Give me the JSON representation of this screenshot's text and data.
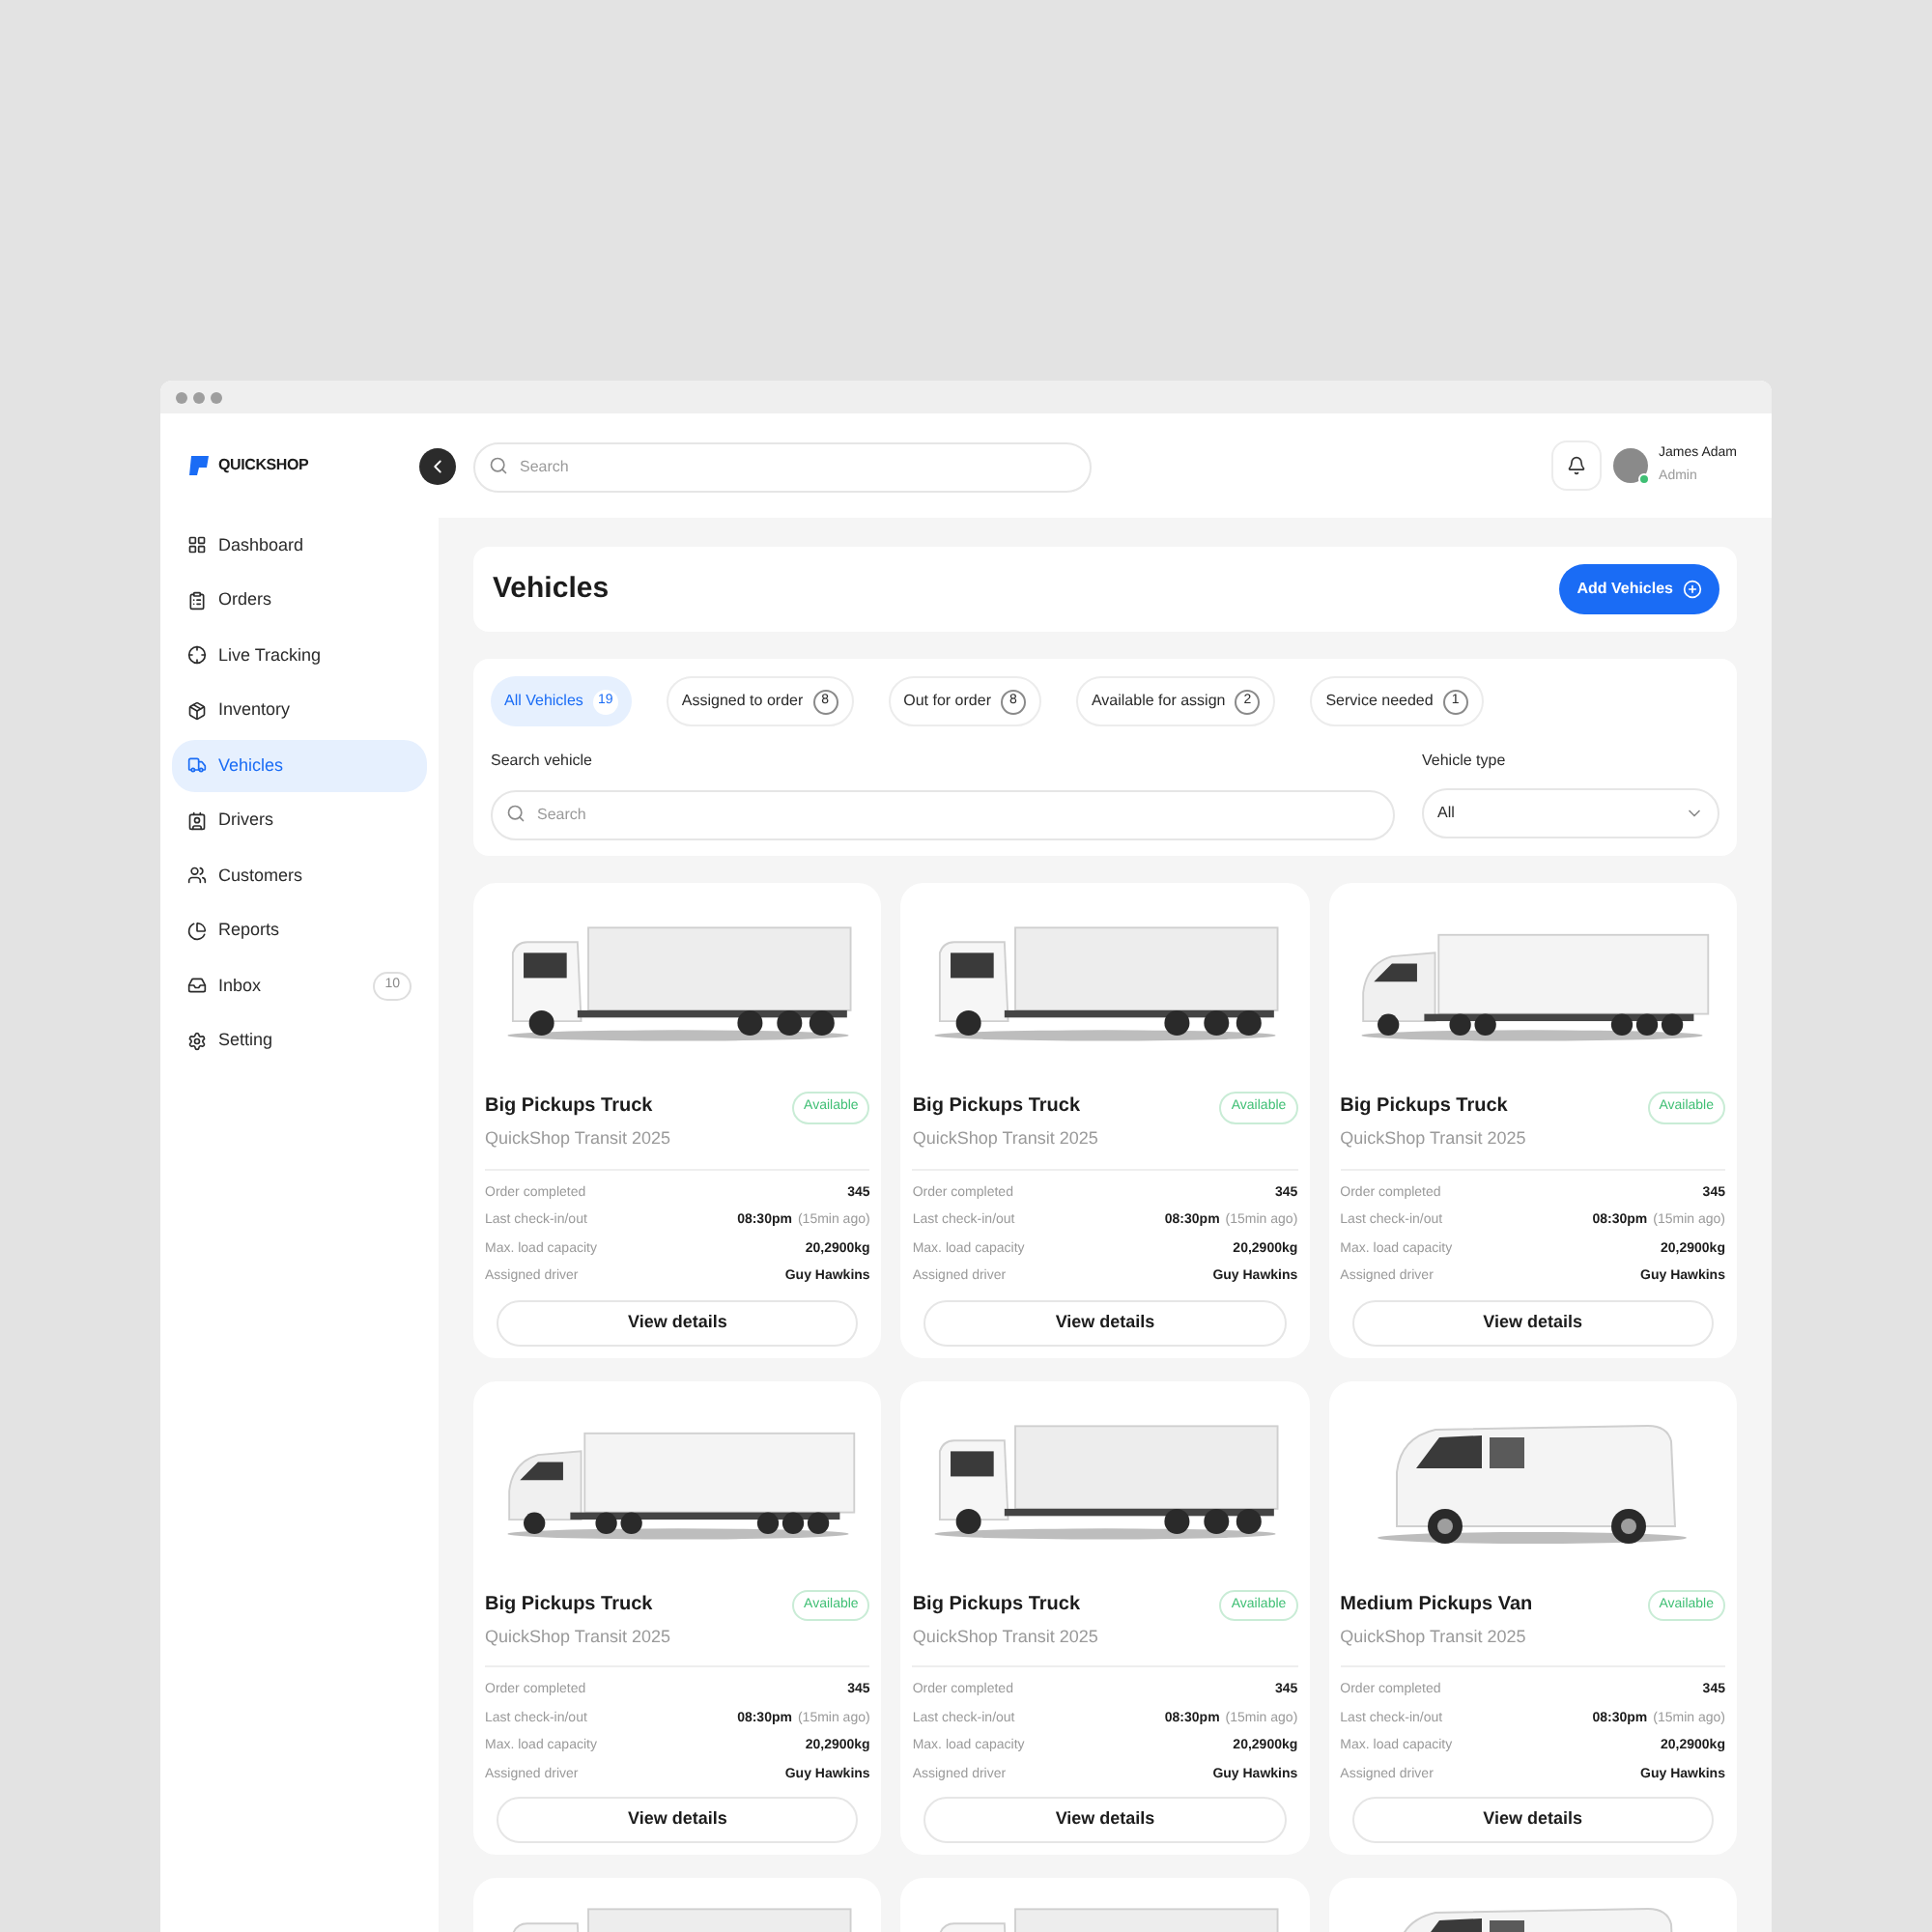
{
  "brand": {
    "name": "QUICKSHOP"
  },
  "header": {
    "search": {
      "placeholder": "Search"
    },
    "user": {
      "name": "James Adam",
      "role": "Admin",
      "online": true
    }
  },
  "sidebar": {
    "items": [
      {
        "label": "Dashboard",
        "selected": false
      },
      {
        "label": "Orders",
        "selected": false
      },
      {
        "label": "Live Tracking",
        "selected": false
      },
      {
        "label": "Inventory",
        "selected": false
      },
      {
        "label": "Vehicles",
        "selected": true
      },
      {
        "label": "Drivers",
        "selected": false
      },
      {
        "label": "Customers",
        "selected": false
      },
      {
        "label": "Reports",
        "selected": false
      },
      {
        "label": "Inbox",
        "selected": false,
        "badge": "10"
      },
      {
        "label": "Setting",
        "selected": false
      }
    ]
  },
  "page": {
    "title": "Vehicles",
    "add_button": "Add Vehicles"
  },
  "tabs": [
    {
      "label": "All Vehicles",
      "count": "19",
      "selected": true
    },
    {
      "label": "Assigned to order",
      "count": "8",
      "selected": false
    },
    {
      "label": "Out for order",
      "count": "8",
      "selected": false
    },
    {
      "label": "Available for assign",
      "count": "2",
      "selected": false
    },
    {
      "label": "Service needed",
      "count": "1",
      "selected": false
    }
  ],
  "filters": {
    "search": {
      "label": "Search vehicle",
      "placeholder": "Search"
    },
    "vehicle_type": {
      "label": "Vehicle type",
      "value": "All"
    }
  },
  "cards": [
    {
      "kind": "truck",
      "name": "Big Pickups Truck",
      "model": "QuickShop Transit 2025",
      "status": "Available",
      "rows": [
        {
          "label": "Order completed",
          "value": "345"
        },
        {
          "label": "Last check-in/out",
          "value": "08:30pm",
          "note": "(15min ago)"
        },
        {
          "label": "Max. load capacity",
          "value": "20,2900kg"
        },
        {
          "label": "Assigned driver",
          "value": "Guy Hawkins"
        }
      ],
      "button": "View details"
    },
    {
      "kind": "truck",
      "name": "Big Pickups Truck",
      "model": "QuickShop Transit 2025",
      "status": "Available",
      "rows": [
        {
          "label": "Order completed",
          "value": "345"
        },
        {
          "label": "Last check-in/out",
          "value": "08:30pm",
          "note": "(15min ago)"
        },
        {
          "label": "Max. load capacity",
          "value": "20,2900kg"
        },
        {
          "label": "Assigned driver",
          "value": "Guy Hawkins"
        }
      ],
      "button": "View details"
    },
    {
      "kind": "semi",
      "name": "Big Pickups Truck",
      "model": "QuickShop Transit 2025",
      "status": "Available",
      "rows": [
        {
          "label": "Order completed",
          "value": "345"
        },
        {
          "label": "Last check-in/out",
          "value": "08:30pm",
          "note": "(15min ago)"
        },
        {
          "label": "Max. load capacity",
          "value": "20,2900kg"
        },
        {
          "label": "Assigned driver",
          "value": "Guy Hawkins"
        }
      ],
      "button": "View details"
    },
    {
      "kind": "semi",
      "name": "Big Pickups Truck",
      "model": "QuickShop Transit 2025",
      "status": "Available",
      "rows": [
        {
          "label": "Order completed",
          "value": "345"
        },
        {
          "label": "Last check-in/out",
          "value": "08:30pm",
          "note": "(15min ago)"
        },
        {
          "label": "Max. load capacity",
          "value": "20,2900kg"
        },
        {
          "label": "Assigned driver",
          "value": "Guy Hawkins"
        }
      ],
      "button": "View details"
    },
    {
      "kind": "truck",
      "name": "Big Pickups Truck",
      "model": "QuickShop Transit 2025",
      "status": "Available",
      "rows": [
        {
          "label": "Order completed",
          "value": "345"
        },
        {
          "label": "Last check-in/out",
          "value": "08:30pm",
          "note": "(15min ago)"
        },
        {
          "label": "Max. load capacity",
          "value": "20,2900kg"
        },
        {
          "label": "Assigned driver",
          "value": "Guy Hawkins"
        }
      ],
      "button": "View details"
    },
    {
      "kind": "van",
      "name": "Medium Pickups Van",
      "model": "QuickShop Transit 2025",
      "status": "Available",
      "rows": [
        {
          "label": "Order completed",
          "value": "345"
        },
        {
          "label": "Last check-in/out",
          "value": "08:30pm",
          "note": "(15min ago)"
        },
        {
          "label": "Max. load capacity",
          "value": "20,2900kg"
        },
        {
          "label": "Assigned driver",
          "value": "Guy Hawkins"
        }
      ],
      "button": "View details"
    }
  ],
  "partial_cards": [
    {
      "kind": "truck"
    },
    {
      "kind": "truck"
    },
    {
      "kind": "van"
    }
  ]
}
